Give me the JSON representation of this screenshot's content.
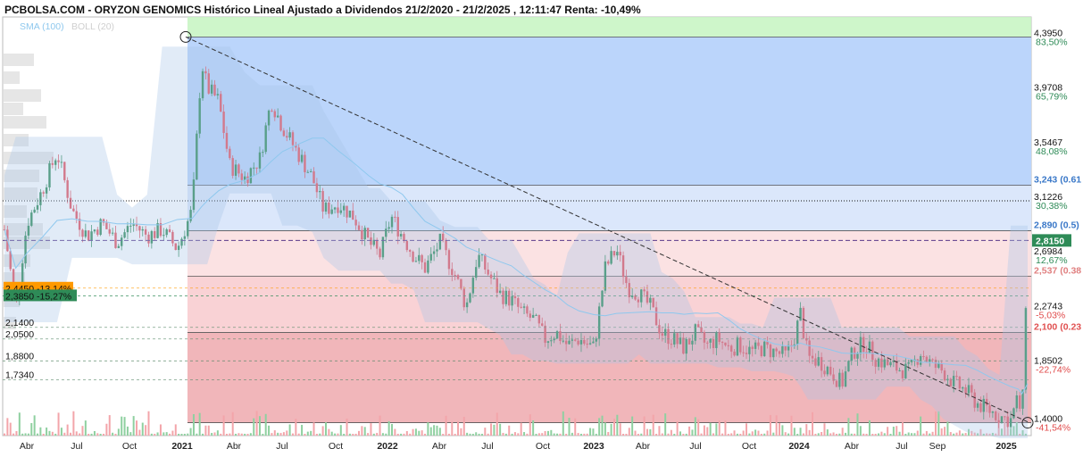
{
  "title": "PCBOLSA.COM - ORYZON GENOMICS Histórico Lineal Ajustado a Dividendos 21/2/2020 - 21/2/2025 , 12:11:47 Renta: -10,49%",
  "legend": [
    {
      "label": "SMA (100)",
      "color": "#8fc8ee"
    },
    {
      "label": "BOLL (20)",
      "color": "#d0d0d0"
    }
  ],
  "colors": {
    "up": "#2e8b57",
    "down": "#e8505b",
    "fib_up": "#7aa8f0",
    "fib_down": "#f5a0a5",
    "top_band": "#c9f5c4"
  },
  "chart_data": {
    "type": "candlestick",
    "x_ticks": [
      "Abr",
      "Jul",
      "Oct",
      "2021",
      "Abr",
      "Jul",
      "Oct",
      "2022",
      "Abr",
      "Jul",
      "Oct",
      "2023",
      "Abr",
      "Jul",
      "Oct",
      "2024",
      "Abr",
      "Jul",
      "Sep",
      "2025"
    ],
    "bold_ticks": [
      "2021",
      "2022",
      "2023",
      "2024",
      "2025"
    ],
    "ylim": [
      1.3,
      4.55
    ],
    "price_labels": [
      "4,3950",
      "3,9708",
      "3,5467",
      "3,1226",
      "2,6984",
      "2,2743",
      "1,8502",
      "1,4000"
    ],
    "percent_labels": [
      "83,50%",
      "65,79%",
      "48,08%",
      "30,38%",
      "12,67%",
      "-5,03%",
      "-22,74%",
      "-41,54%"
    ],
    "fib_levels": [
      {
        "label": "3,243 (0.61",
        "value": 3.243,
        "color": "#3a78c8"
      },
      {
        "label": "2,890 (0.5)",
        "value": 2.89,
        "color": "#3a78c8"
      },
      {
        "label": "2,537 (0.38",
        "value": 2.537,
        "color": "#e08080"
      },
      {
        "label": "2,100 (0.23",
        "value": 2.1,
        "color": "#e05050"
      }
    ],
    "fib_high": 4.395,
    "fib_low": 1.4,
    "current_price": {
      "label": "2,8150",
      "value": 2.815
    },
    "left_levels": [
      {
        "label": "2,4450 -13,14%",
        "value": 2.445,
        "color": "#ff9900"
      },
      {
        "label": "2,3850 -15,27%",
        "value": 2.385,
        "color": "#2e8b57"
      },
      {
        "label": "2,1400",
        "value": 2.14
      },
      {
        "label": "2,0500",
        "value": 2.05
      },
      {
        "label": "1,8800",
        "value": 1.88
      },
      {
        "label": "1,7340",
        "value": 1.734
      }
    ],
    "trendline": {
      "from": [
        "2021",
        4.395
      ],
      "to": [
        "2025",
        1.4
      ]
    },
    "anchor_points": [
      {
        "x": "2021",
        "value": 4.395
      },
      {
        "x": "2025",
        "value": 1.4
      }
    ],
    "series_path": [
      [
        0,
        2.9
      ],
      [
        6,
        2.3
      ],
      [
        12,
        2.95
      ],
      [
        20,
        3.2
      ],
      [
        28,
        3.5
      ],
      [
        36,
        3.05
      ],
      [
        44,
        2.85
      ],
      [
        52,
        2.95
      ],
      [
        60,
        2.8
      ],
      [
        68,
        2.95
      ],
      [
        76,
        2.85
      ],
      [
        84,
        2.9
      ],
      [
        92,
        2.75
      ],
      [
        100,
        3.05
      ],
      [
        105,
        4.2
      ],
      [
        108,
        4.0
      ],
      [
        114,
        3.9
      ],
      [
        120,
        3.4
      ],
      [
        128,
        3.3
      ],
      [
        136,
        3.45
      ],
      [
        142,
        3.9
      ],
      [
        148,
        3.7
      ],
      [
        156,
        3.5
      ],
      [
        164,
        3.3
      ],
      [
        170,
        3.05
      ],
      [
        178,
        3.1
      ],
      [
        186,
        3.0
      ],
      [
        194,
        2.8
      ],
      [
        200,
        2.7
      ],
      [
        206,
        3.0
      ],
      [
        212,
        2.85
      ],
      [
        218,
        2.7
      ],
      [
        224,
        2.6
      ],
      [
        232,
        2.8
      ],
      [
        240,
        2.55
      ],
      [
        246,
        2.3
      ],
      [
        252,
        2.7
      ],
      [
        258,
        2.55
      ],
      [
        264,
        2.4
      ],
      [
        270,
        2.35
      ],
      [
        276,
        2.25
      ],
      [
        282,
        2.2
      ],
      [
        288,
        2.05
      ],
      [
        294,
        2.1
      ],
      [
        300,
        2.0
      ],
      [
        306,
        2.05
      ],
      [
        314,
        1.98
      ],
      [
        320,
        2.6
      ],
      [
        326,
        2.75
      ],
      [
        332,
        2.45
      ],
      [
        338,
        2.4
      ],
      [
        344,
        2.3
      ],
      [
        350,
        2.1
      ],
      [
        356,
        2.05
      ],
      [
        362,
        1.98
      ],
      [
        368,
        2.1
      ],
      [
        374,
        2.0
      ],
      [
        380,
        2.05
      ],
      [
        386,
        1.98
      ],
      [
        392,
        2.0
      ],
      [
        398,
        1.95
      ],
      [
        404,
        1.98
      ],
      [
        410,
        1.95
      ],
      [
        416,
        1.92
      ],
      [
        420,
        2.02
      ],
      [
        424,
        2.25
      ],
      [
        428,
        1.9
      ],
      [
        434,
        1.88
      ],
      [
        440,
        1.8
      ],
      [
        446,
        1.7
      ],
      [
        452,
        1.95
      ],
      [
        458,
        2.02
      ],
      [
        464,
        1.9
      ],
      [
        470,
        1.85
      ],
      [
        476,
        1.82
      ],
      [
        482,
        1.8
      ],
      [
        488,
        1.95
      ],
      [
        494,
        1.85
      ],
      [
        500,
        1.8
      ],
      [
        506,
        1.7
      ],
      [
        512,
        1.65
      ],
      [
        518,
        1.55
      ],
      [
        524,
        1.5
      ],
      [
        530,
        1.45
      ],
      [
        536,
        1.42
      ],
      [
        540,
        1.6
      ],
      [
        542,
        1.4
      ],
      [
        545,
        2.81
      ]
    ]
  }
}
